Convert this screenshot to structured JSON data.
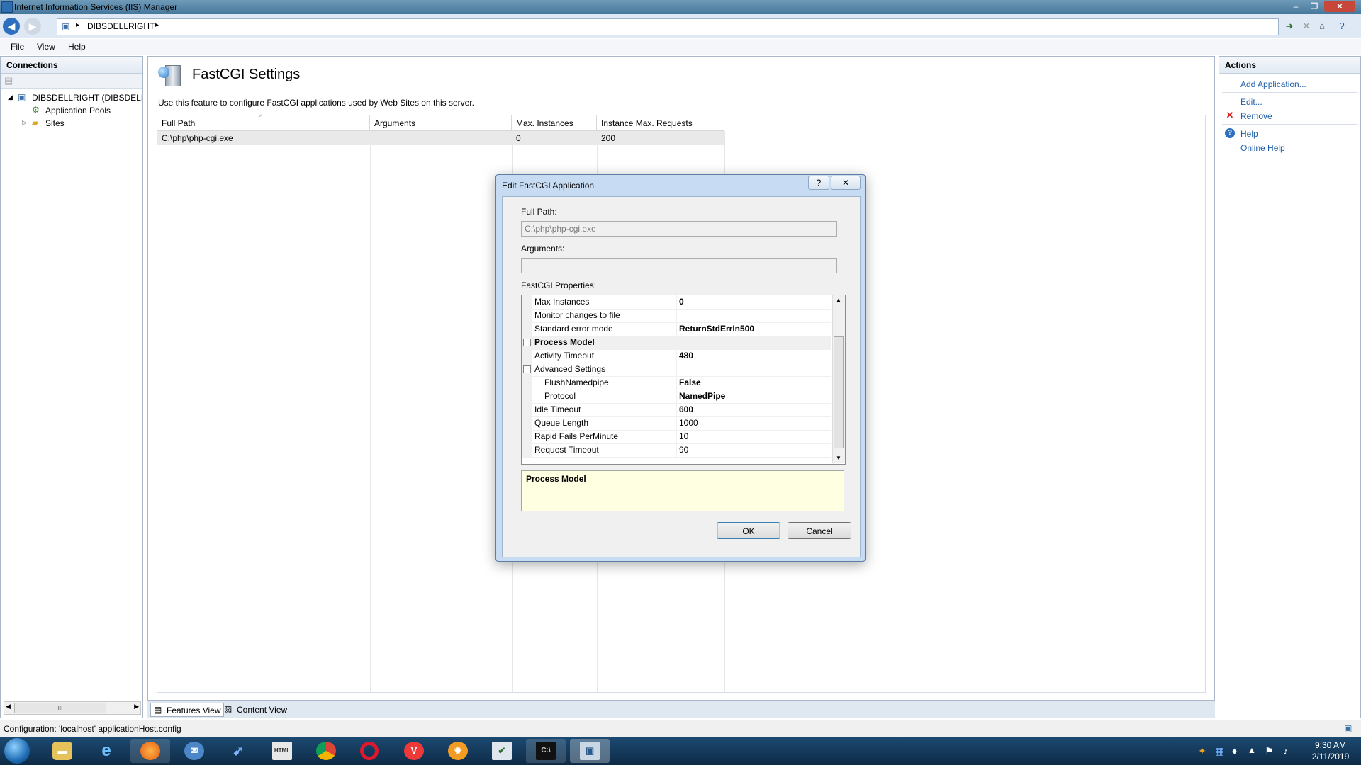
{
  "window": {
    "title": "Internet Information Services (IIS) Manager"
  },
  "address": {
    "crumbs": [
      "DIBSDELLRIGHT"
    ]
  },
  "menu": [
    "File",
    "View",
    "Help"
  ],
  "connections": {
    "title": "Connections",
    "tree": [
      {
        "label": "DIBSDELLRIGHT (DIBSDELLRIG",
        "expanded": true
      },
      {
        "label": "Application Pools"
      },
      {
        "label": "Sites",
        "expanded": false
      }
    ],
    "scroll_glyph": "III"
  },
  "page": {
    "title": "FastCGI Settings",
    "description": "Use this feature to configure FastCGI applications used by Web Sites on this server.",
    "columns": [
      "Full Path",
      "Arguments",
      "Max. Instances",
      "Instance Max. Requests"
    ],
    "rows": [
      {
        "full_path": "C:\\php\\php-cgi.exe",
        "arguments": "",
        "max_instances": "0",
        "instance_max_requests": "200"
      }
    ]
  },
  "view_tabs": [
    "Features View",
    "Content View"
  ],
  "actions": {
    "title": "Actions",
    "items": [
      {
        "label": "Add Application...",
        "icon": "none"
      },
      {
        "label": "Edit...",
        "icon": "none"
      },
      {
        "label": "Remove",
        "icon": "red-x-icon"
      },
      {
        "label": "Help",
        "icon": "help-icon"
      },
      {
        "label": "Online Help",
        "icon": "none"
      }
    ]
  },
  "status": {
    "text": "Configuration: 'localhost' applicationHost.config"
  },
  "dialog": {
    "title": "Edit FastCGI Application",
    "help_glyph": "?",
    "close_glyph": "✕",
    "full_path_label": "Full Path:",
    "full_path_value": "C:\\php\\php-cgi.exe",
    "arguments_label": "Arguments:",
    "arguments_value": "",
    "props_label": "FastCGI Properties:",
    "properties": [
      {
        "name": "Max Instances",
        "value": "0",
        "bold": true
      },
      {
        "name": "Monitor changes to file",
        "value": ""
      },
      {
        "name": "Standard error mode",
        "value": "ReturnStdErrIn500",
        "bold": true
      },
      {
        "name": "Process Model",
        "value": "",
        "category": true
      },
      {
        "name": "Activity Timeout",
        "value": "480",
        "bold": true
      },
      {
        "name": "Advanced Settings",
        "value": "",
        "subcategory": true
      },
      {
        "name": "FlushNamedpipe",
        "value": "False",
        "bold": true
      },
      {
        "name": "Protocol",
        "value": "NamedPipe",
        "bold": true
      },
      {
        "name": "Idle Timeout",
        "value": "600",
        "bold": true
      },
      {
        "name": "Queue Length",
        "value": "1000"
      },
      {
        "name": "Rapid Fails PerMinute",
        "value": "10"
      },
      {
        "name": "Request Timeout",
        "value": "90"
      }
    ],
    "description_title": "Process Model",
    "ok_label": "OK",
    "cancel_label": "Cancel"
  },
  "taskbar": {
    "apps": [
      "start-orb",
      "file-explorer",
      "internet-explorer",
      "firefox",
      "thunderbird",
      "blue-app",
      "html-kit",
      "chrome",
      "opera",
      "vivaldi",
      "orange-app",
      "check-app",
      "command-prompt",
      "iis-manager"
    ],
    "time": "9:30 AM",
    "date": "2/11/2019"
  }
}
